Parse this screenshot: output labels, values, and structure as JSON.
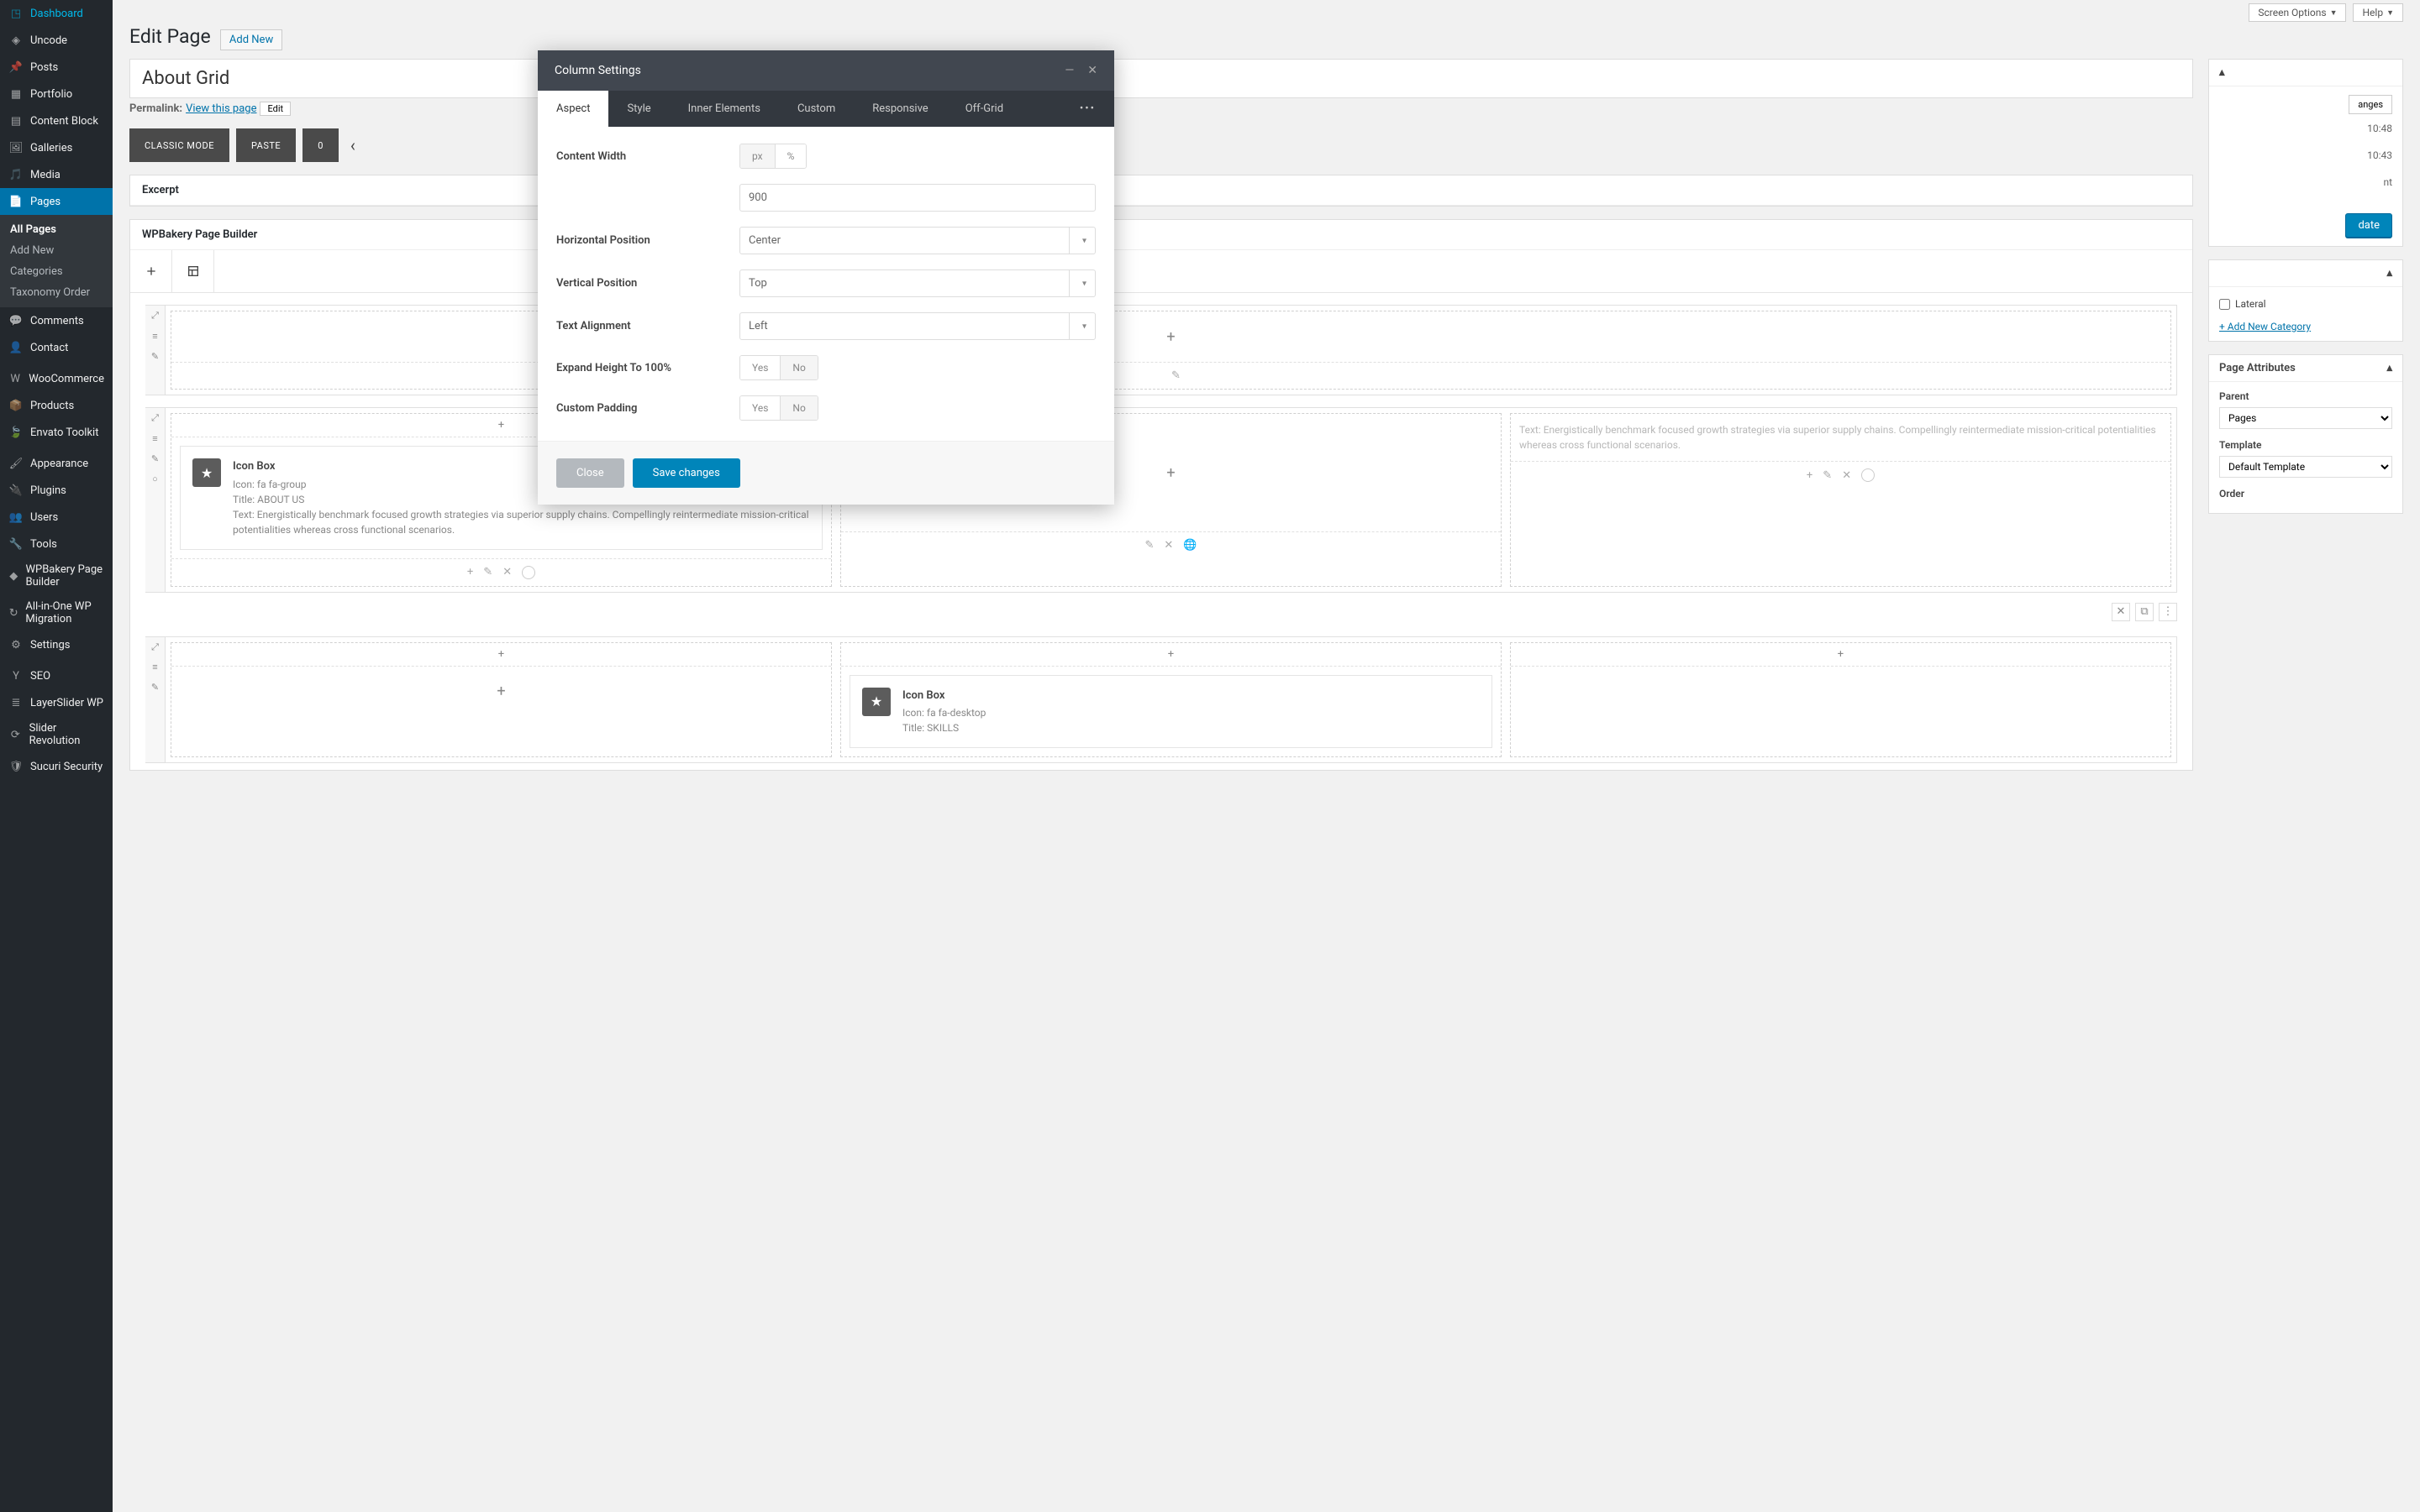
{
  "top": {
    "screen_options": "Screen Options",
    "help": "Help"
  },
  "heading": {
    "title": "Edit Page",
    "add_new": "Add New"
  },
  "post": {
    "title": "About Grid",
    "permalink_label": "Permalink:",
    "permalink_view": "View this page",
    "edit": "Edit"
  },
  "toolbar": {
    "classic_mode": "CLASSIC MODE",
    "paste": "PASTE",
    "counter": "0"
  },
  "sidebar_menu": [
    {
      "label": "Dashboard",
      "icon": "dashboard"
    },
    {
      "label": "Uncode",
      "icon": "uncode"
    },
    {
      "label": "Posts",
      "icon": "pin"
    },
    {
      "label": "Portfolio",
      "icon": "grid"
    },
    {
      "label": "Content Block",
      "icon": "block"
    },
    {
      "label": "Galleries",
      "icon": "image"
    },
    {
      "label": "Media",
      "icon": "media"
    },
    {
      "label": "Pages",
      "icon": "page",
      "active": true,
      "submenu": [
        "All Pages",
        "Add New",
        "Categories",
        "Taxonomy Order"
      ]
    },
    {
      "label": "Comments",
      "icon": "comment"
    },
    {
      "label": "Contact",
      "icon": "person"
    },
    {
      "label": "WooCommerce",
      "icon": "woo"
    },
    {
      "label": "Products",
      "icon": "product"
    },
    {
      "label": "Envato Toolkit",
      "icon": "envato"
    },
    {
      "label": "Appearance",
      "icon": "brush"
    },
    {
      "label": "Plugins",
      "icon": "plug"
    },
    {
      "label": "Users",
      "icon": "users"
    },
    {
      "label": "Tools",
      "icon": "wrench"
    },
    {
      "label": "WPBakery Page Builder",
      "icon": "wpb"
    },
    {
      "label": "All-in-One WP Migration",
      "icon": "migrate"
    },
    {
      "label": "Settings",
      "icon": "settings"
    },
    {
      "label": "SEO",
      "icon": "seo"
    },
    {
      "label": "LayerSlider WP",
      "icon": "layers"
    },
    {
      "label": "Slider Revolution",
      "icon": "rev"
    },
    {
      "label": "Sucuri Security",
      "icon": "shield"
    }
  ],
  "panels": {
    "excerpt": "Excerpt",
    "wpbakery": "WPBakery Page Builder"
  },
  "icon_box": {
    "title": "Icon Box",
    "icon_line": "Icon: fa fa-group",
    "title_line": "Title: ABOUT US",
    "text": "Text: Energistically benchmark focused growth strategies via superior supply chains. Compellingly reintermediate mission-critical potentialities whereas cross functional scenarios."
  },
  "icon_box2": {
    "title": "Icon Box",
    "icon_line": "Icon: fa fa-desktop",
    "title_line": "Title: SKILLS"
  },
  "modal": {
    "title": "Column Settings",
    "tabs": [
      "Aspect",
      "Style",
      "Inner Elements",
      "Custom",
      "Responsive",
      "Off-Grid"
    ],
    "fields": {
      "content_width": {
        "label": "Content Width",
        "opts": [
          "px",
          "%"
        ],
        "value": "900"
      },
      "h_pos": {
        "label": "Horizontal Position",
        "value": "Center"
      },
      "v_pos": {
        "label": "Vertical Position",
        "value": "Top"
      },
      "text_align": {
        "label": "Text Alignment",
        "value": "Left"
      },
      "expand": {
        "label": "Expand Height To 100%",
        "opts": [
          "Yes",
          "No"
        ]
      },
      "padding": {
        "label": "Custom Padding",
        "opts": [
          "Yes",
          "No"
        ]
      }
    },
    "footer": {
      "close": "Close",
      "save": "Save changes"
    }
  },
  "publish": {
    "preview": "Preview Changes",
    "published_time": "10:48",
    "modified_time": "10:43",
    "update": "Update"
  },
  "categories": {
    "lateral": "Lateral",
    "add_new": "+ Add New Category"
  },
  "attributes": {
    "title": "Page Attributes",
    "parent_label": "Parent",
    "parent_value": "Pages",
    "template_label": "Template",
    "template_value": "Default Template",
    "order_label": "Order"
  }
}
